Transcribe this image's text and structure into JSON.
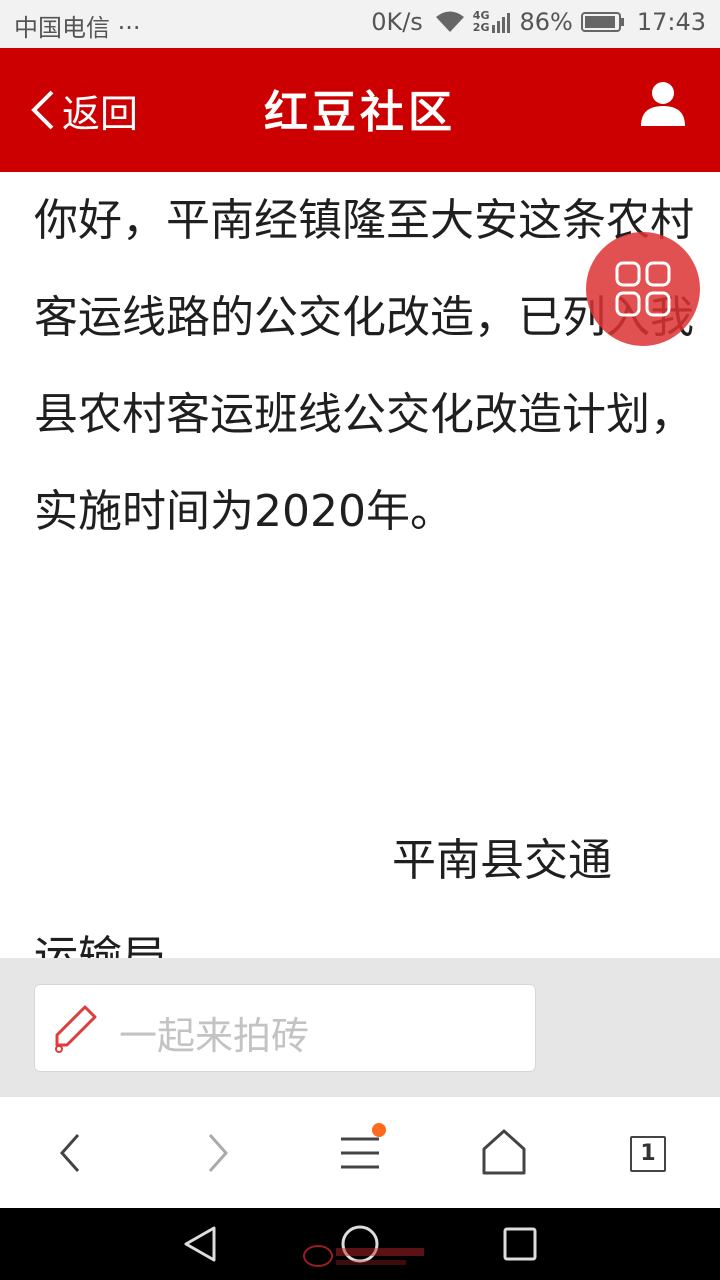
{
  "status_bar": {
    "carrier": "中国电信 ···",
    "speed": "0K/s",
    "network_type_top": "4G",
    "network_type_bottom": "2G",
    "battery": "86%",
    "time": "17:43"
  },
  "header": {
    "back_label": "返回",
    "title": "红豆社区",
    "icons": {
      "back": "chevron-left-icon",
      "user": "user-icon"
    },
    "background_color": "#cc0000"
  },
  "article": {
    "paragraph": "你好，平南经镇隆至大安这条农村客运线路的公交化改造，已列入我县农村客运班线公交化改造计划，实施时间为2020年。",
    "signature_line1": "平南县交通",
    "signature_line2": "运输局"
  },
  "float_menu": {
    "icon": "grid-icon",
    "color": "#dc3232"
  },
  "comment": {
    "placeholder": "一起来拍砖",
    "icon": "pencil-icon"
  },
  "browser_nav": {
    "tab_count": "1",
    "icons": [
      "back-icon",
      "forward-icon",
      "menu-icon",
      "home-icon",
      "tabs-icon"
    ],
    "badge_color": "#ff6a1f"
  },
  "system_nav": {
    "icons": [
      "back-triangle-icon",
      "home-circle-icon",
      "recent-square-icon"
    ]
  }
}
